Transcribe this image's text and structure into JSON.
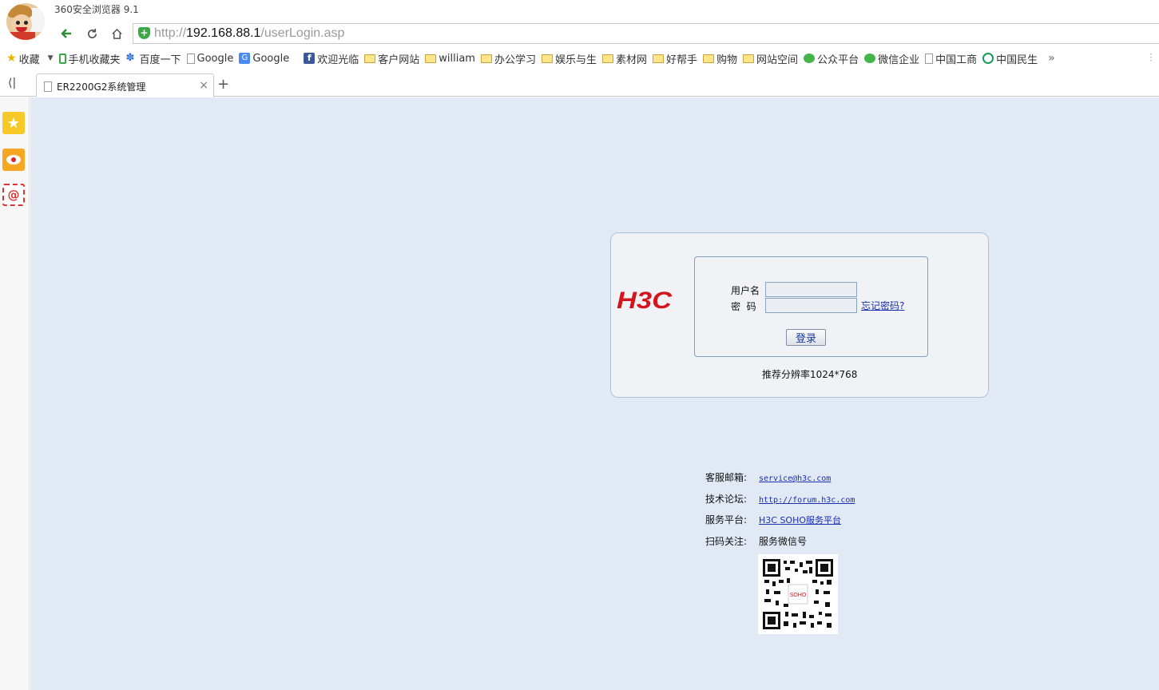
{
  "browser": {
    "title": "360安全浏览器 9.1",
    "url_scheme": "http://",
    "url_host": "192.168.88.1",
    "url_path": "/userLogin.asp"
  },
  "bookmarks": [
    {
      "label": "收藏",
      "icon": "star-icon"
    },
    {
      "label": "手机收藏夹",
      "icon": "phone-icon"
    },
    {
      "label": "百度一下",
      "icon": "baidu-paw-icon"
    },
    {
      "label": "Google",
      "icon": "page-icon"
    },
    {
      "label": "Google",
      "icon": "google-translate-icon"
    },
    {
      "label": "欢迎光临",
      "icon": "facebook-icon"
    },
    {
      "label": "客户网站",
      "icon": "folder-icon"
    },
    {
      "label": "william",
      "icon": "folder-icon"
    },
    {
      "label": "办公学习",
      "icon": "folder-icon"
    },
    {
      "label": "娱乐与生",
      "icon": "folder-icon"
    },
    {
      "label": "素材网",
      "icon": "folder-icon"
    },
    {
      "label": "好帮手",
      "icon": "folder-icon"
    },
    {
      "label": "购物",
      "icon": "folder-icon"
    },
    {
      "label": "网站空间",
      "icon": "folder-icon"
    },
    {
      "label": "公众平台",
      "icon": "wechat-icon"
    },
    {
      "label": "微信企业",
      "icon": "wechat-icon"
    },
    {
      "label": "中国工商",
      "icon": "page-icon"
    },
    {
      "label": "中国民生",
      "icon": "bank-icon"
    }
  ],
  "tab": {
    "label": "ER2200G2系统管理",
    "close": "×",
    "new_tab": "+"
  },
  "login": {
    "logo": "H3C",
    "username_label": "用户名",
    "password_label": "密  码",
    "forgot_link": "忘记密码?",
    "submit_label": "登录",
    "resolution_hint": "推荐分辨率1024*768"
  },
  "info": {
    "email_label": "客服邮箱:",
    "email_value": "service@h3c.com",
    "forum_label": "技术论坛:",
    "forum_value": "http://forum.h3c.com",
    "platform_label": "服务平台:",
    "platform_value": "H3C SOHO服务平台",
    "scan_label": "扫码关注:",
    "scan_value": "服务微信号"
  },
  "colors": {
    "content_bg": "#e1e9f5",
    "brand_red": "#d3161e",
    "link_blue": "#1a2fb0"
  }
}
